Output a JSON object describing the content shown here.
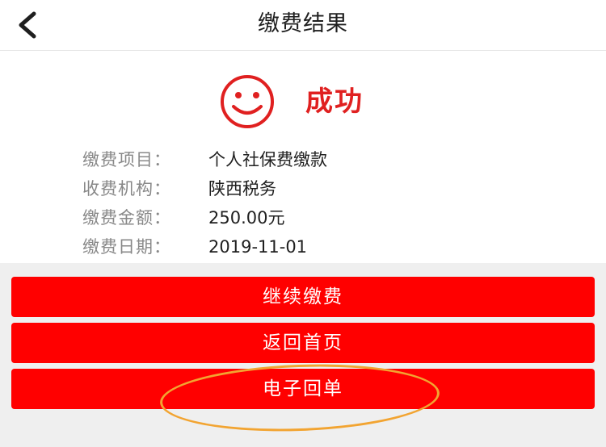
{
  "header": {
    "title": "缴费结果",
    "back_icon": "chevron-left-icon"
  },
  "result": {
    "icon": "smiley-face-icon",
    "text": "成功",
    "color": "#e02020"
  },
  "details": [
    {
      "label": "缴费项目：",
      "value": "个人社保费缴款"
    },
    {
      "label": "收费机构：",
      "value": "陕西税务"
    },
    {
      "label": "缴费金额：",
      "value": "250.00元"
    },
    {
      "label": "缴费日期：",
      "value": "2019-11-01"
    }
  ],
  "buttons": {
    "continue": "继续缴费",
    "home": "返回首页",
    "receipt": "电子回单",
    "color": "#ff0000"
  },
  "annotation": {
    "circle_color": "#f2a431"
  }
}
